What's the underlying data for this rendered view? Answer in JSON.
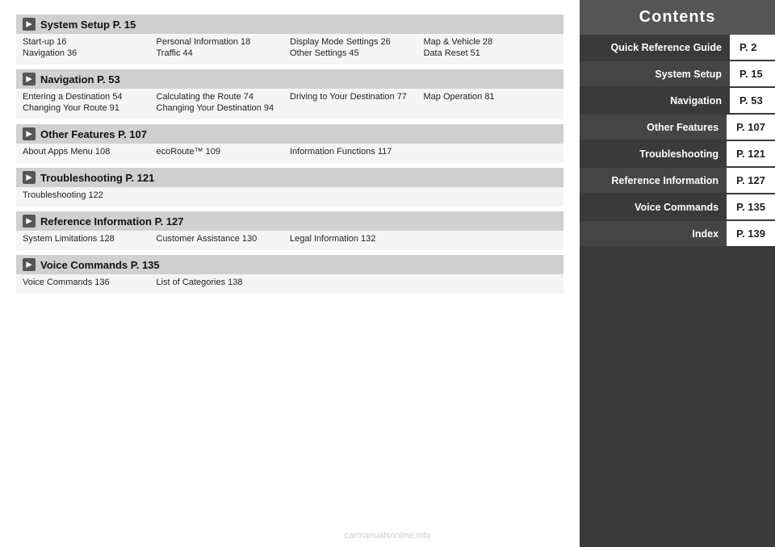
{
  "sidebar": {
    "title": "Contents",
    "items": [
      {
        "label": "Quick Reference Guide",
        "page": "P. 2"
      },
      {
        "label": "System Setup",
        "page": "P. 15"
      },
      {
        "label": "Navigation",
        "page": "P. 53"
      },
      {
        "label": "Other Features",
        "page": "P. 107"
      },
      {
        "label": "Troubleshooting",
        "page": "P. 121"
      },
      {
        "label": "Reference Information",
        "page": "P. 127"
      },
      {
        "label": "Voice Commands",
        "page": "P. 135"
      },
      {
        "label": "Index",
        "page": "P. 139"
      }
    ]
  },
  "sections": [
    {
      "id": "system-setup",
      "header": "System Setup P. 15",
      "rows": [
        [
          "Start-up 16",
          "Personal Information 18",
          "Display Mode Settings 26",
          "Map & Vehicle 28"
        ],
        [
          "Navigation 36",
          "Traffic 44",
          "Other Settings 45",
          "Data Reset 51"
        ]
      ]
    },
    {
      "id": "navigation",
      "header": "Navigation P. 53",
      "rows": [
        [
          "Entering a Destination 54",
          "Calculating the Route 74",
          "Driving to Your Destination 77",
          "Map Operation 81"
        ],
        [
          "Changing Your Route 91",
          "Changing Your Destination 94",
          "",
          ""
        ]
      ]
    },
    {
      "id": "other-features",
      "header": "Other Features P. 107",
      "rows": [
        [
          "About Apps Menu 108",
          "ecoRoute™ 109",
          "Information Functions 117",
          ""
        ]
      ]
    },
    {
      "id": "troubleshooting",
      "header": "Troubleshooting P. 121",
      "rows": [
        [
          "Troubleshooting 122",
          "",
          "",
          ""
        ]
      ]
    },
    {
      "id": "reference-information",
      "header": "Reference Information P. 127",
      "rows": [
        [
          "System Limitations 128",
          "Customer Assistance 130",
          "Legal Information 132",
          ""
        ]
      ]
    },
    {
      "id": "voice-commands",
      "header": "Voice Commands P. 135",
      "rows": [
        [
          "Voice Commands 136",
          "List of Categories 138",
          "",
          ""
        ]
      ]
    }
  ]
}
